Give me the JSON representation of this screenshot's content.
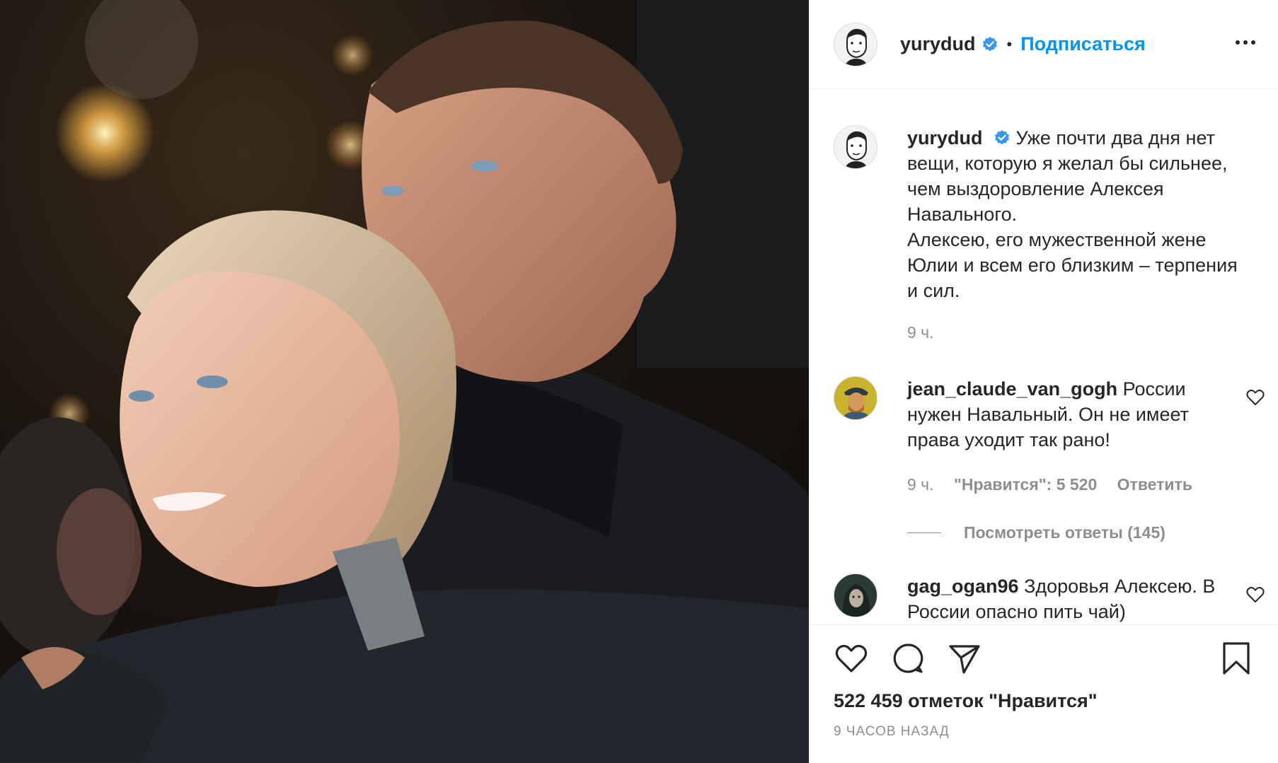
{
  "post": {
    "username": "yurydud",
    "follow_label": "Подписаться",
    "dot": "•"
  },
  "caption": {
    "username": "yurydud",
    "text": "Уже почти два дня нет вещи, которую я желал бы сильнее, чем выздоровление Алексея Навального.",
    "text2": "Алексею, его мужественной жене Юлии и всем его близким – терпения и сил.",
    "time": "9 ч."
  },
  "comments": [
    {
      "username": "jean_claude_van_gogh",
      "text": "России нужен Навальный. Он не имеет права уходит так рано!",
      "time": "9 ч.",
      "likes": "\"Нравится\": 5 520",
      "reply_label": "Ответить",
      "view_replies": "Посмотреть ответы (145)"
    },
    {
      "username": "gag_ogan96",
      "text": "Здоровья Алексею. В России опасно пить чай)"
    }
  ],
  "footer": {
    "likes_count": "522 459 отметок \"Нравится\"",
    "time_ago": "9 часов назад"
  },
  "icons": {
    "verified": "verified-badge-icon",
    "more": "more-options-icon",
    "like": "heart-icon",
    "comment": "comment-icon",
    "share": "paper-plane-icon",
    "save": "bookmark-icon"
  },
  "colors": {
    "link_blue": "#0095f6",
    "verified_blue": "#3897f0",
    "secondary_text": "#8e8e8e",
    "primary_text": "#262626"
  }
}
